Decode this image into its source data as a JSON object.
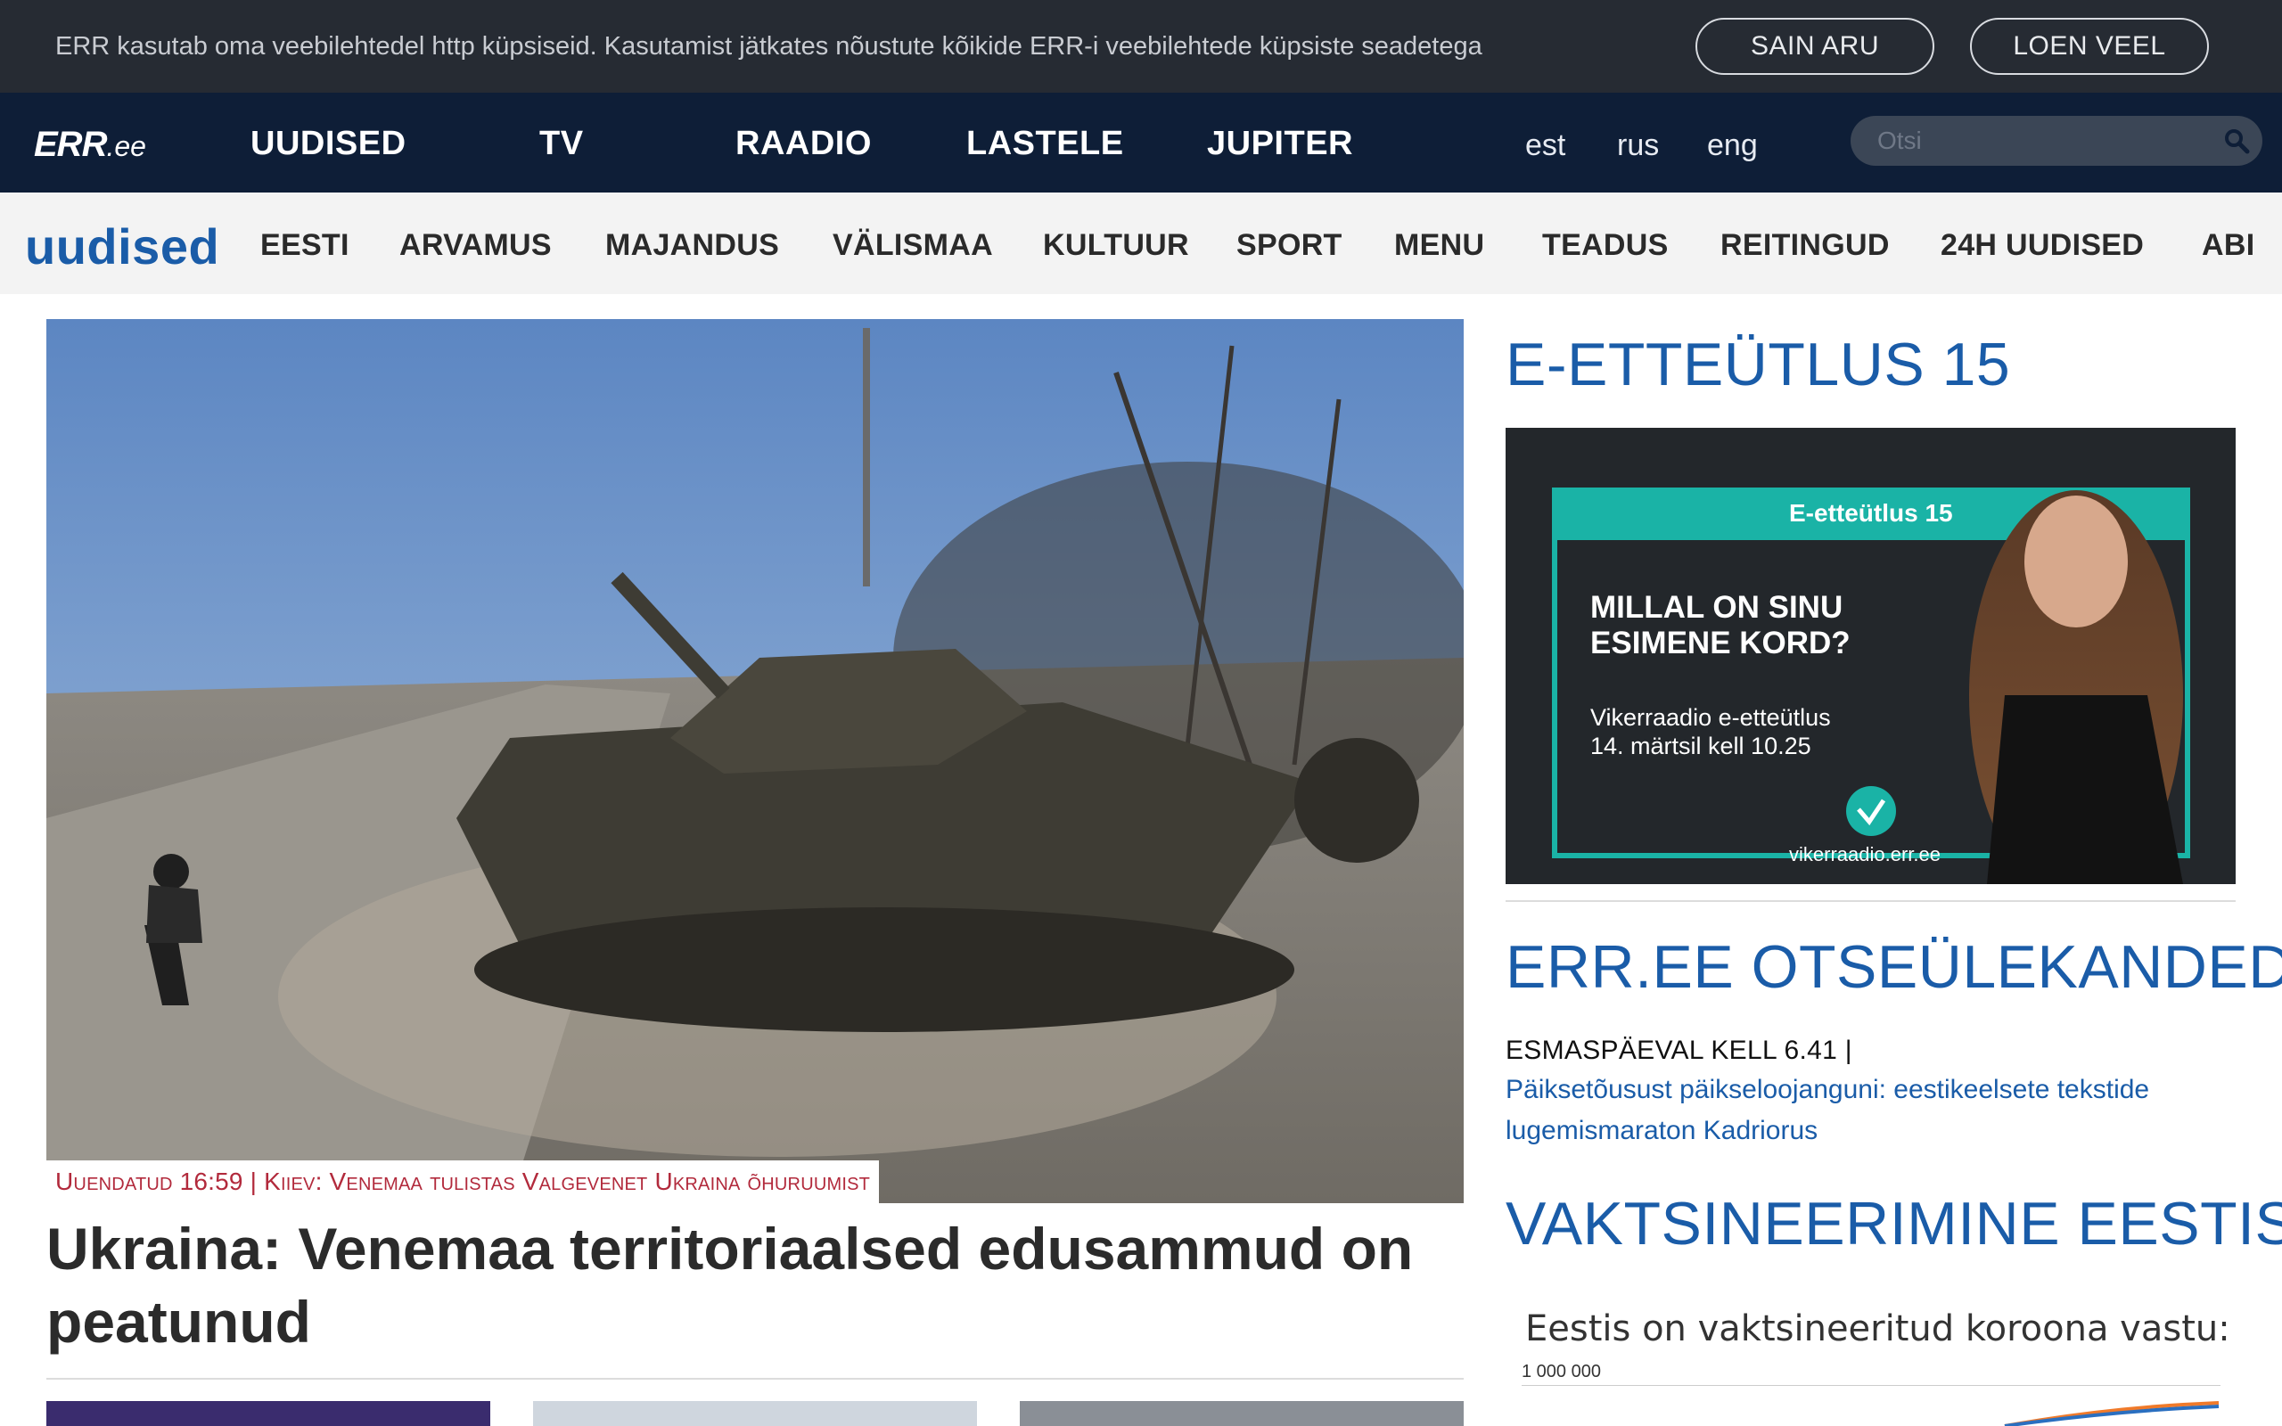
{
  "cookie": {
    "text": "ERR kasutab oma veebilehtedel http küpsiseid. Kasutamist jätkates nõustute kõikide ERR-i veebilehtede küpsiste seadetega",
    "agree_label": "SAIN ARU",
    "more_label": "LOEN VEEL"
  },
  "header": {
    "logo_main": "ERR",
    "logo_suffix": ".ee",
    "nav": [
      "UUDISED",
      "TV",
      "RAADIO",
      "LASTELE",
      "JUPITER"
    ],
    "langs": [
      "est",
      "rus",
      "eng"
    ],
    "search_placeholder": "Otsi"
  },
  "subnav": {
    "brand": "uudised",
    "items": [
      "EESTI",
      "ARVAMUS",
      "MAJANDUS",
      "VÄLISMAA",
      "KULTUUR",
      "SPORT",
      "MENU",
      "TEADUS",
      "REITINGUD",
      "24H UUDISED",
      "ABI"
    ]
  },
  "hero": {
    "caption": "Uuendatud 16:59 | Kiiev: Venemaa tulistas Valgevenet Ukraina õhuruumist",
    "headline": "Ukraina: Venemaa territoriaalsed edusammud on peatunud"
  },
  "sidebar": {
    "section1_title": "E-ETTEÜTLUS 15",
    "banner": {
      "tag": "E-etteütlus 15",
      "question_line1": "MILLAL ON SINU",
      "question_line2": "ESIMENE KORD?",
      "info_line1": "Vikerraadio e-etteütlus",
      "info_line2": "14. märtsil kell 10.25",
      "site": "vikerraadio.err.ee"
    },
    "section2_title": "ERR.EE OTSEÜLEKANDED",
    "live_time": "ESMASPÄEVAL KELL 6.41 |",
    "live_title": "Päiksetõusust päikseloojanguni: eestikeelsete tekstide lugemismaraton Kadriorus",
    "section3_title": "VAKTSINEERIMINE EESTIS",
    "vacc_title": "Eestis on vaktsineeritud koroona vastu:",
    "vacc_axis_label": "1 000 000"
  },
  "colors": {
    "cookie_bg": "#262b33",
    "nav_bg": "#0e1e37",
    "subnav_bg": "#f3f3f3",
    "accent_blue": "#1a5ca8",
    "caption_red": "#b22a3c",
    "banner_teal": "#1ab3a6"
  }
}
